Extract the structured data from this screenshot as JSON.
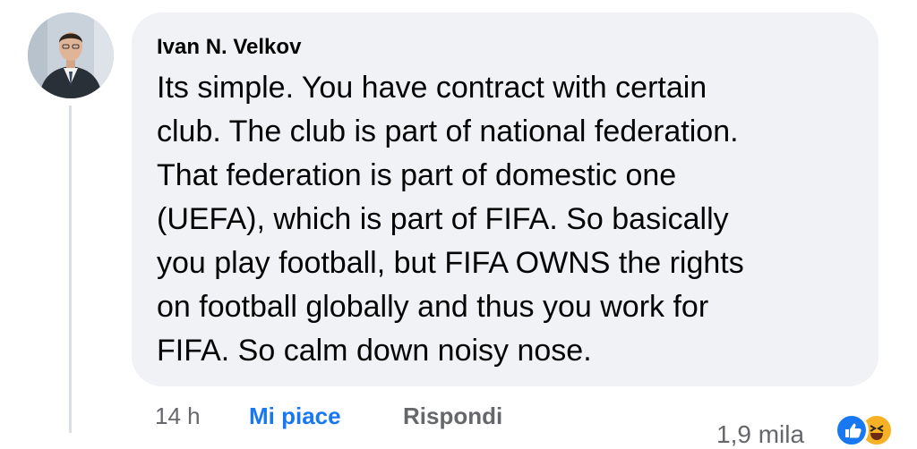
{
  "comment": {
    "author": "Ivan N. Velkov",
    "lines": [
      "Its simple. You have contract with certain",
      "club. The club is part of national federation.",
      "That federation is part of domestic one",
      "(UEFA), which is part of FIFA. So basically",
      "you play football, but FIFA OWNS the rights",
      "on football globally and thus you work for",
      "FIFA. So calm down noisy nose."
    ]
  },
  "actions": {
    "time": "14 h",
    "like_label": "Mi piace",
    "reply_label": "Rispondi"
  },
  "reactions": {
    "count": "1,9 mila",
    "icons": [
      "like-icon",
      "haha-icon"
    ]
  },
  "colors": {
    "bubble": "#f0f2f5",
    "like_active": "#1877f2",
    "secondary_text": "#65676b"
  }
}
